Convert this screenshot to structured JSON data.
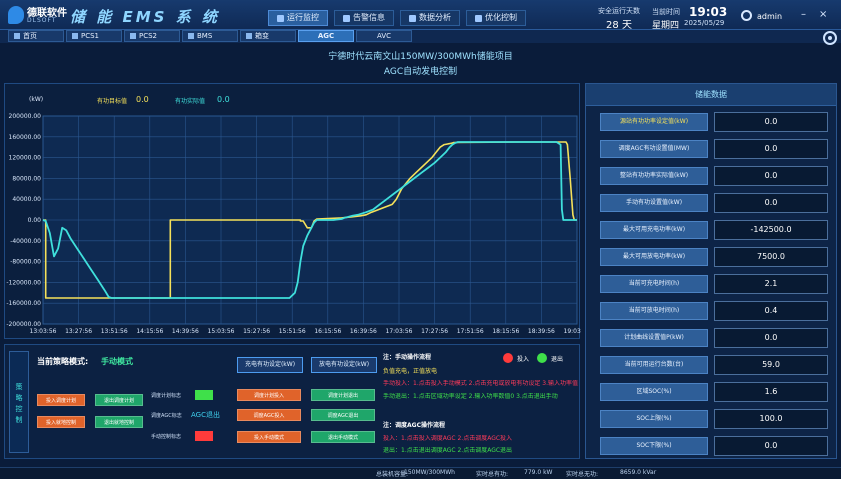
{
  "header": {
    "logo_text": "德联软件",
    "logo_sub": "DLSOFT",
    "system_title": "储 能 EMS 系 统",
    "nav": [
      {
        "label": "运行监控",
        "active": true,
        "icon": "monitor-icon"
      },
      {
        "label": "告警信息",
        "active": false,
        "icon": "alarm-icon"
      },
      {
        "label": "数据分析",
        "active": false,
        "icon": "chart-icon"
      },
      {
        "label": "优化控制",
        "active": false,
        "icon": "optimize-icon"
      }
    ],
    "run_days_label": "安全运行天数",
    "run_days_value": "28 天",
    "time_label": "当前时间",
    "weekday": "星期四",
    "clock": "19:03",
    "date": "2025/05/29",
    "user": "admin"
  },
  "tabs": [
    {
      "label": "首页",
      "active": false
    },
    {
      "label": "PCS1",
      "active": false
    },
    {
      "label": "PCS2",
      "active": false
    },
    {
      "label": "BMS",
      "active": false
    },
    {
      "label": "箱变",
      "active": false
    },
    {
      "label": "AGC",
      "active": true
    },
    {
      "label": "AVC",
      "active": false
    }
  ],
  "project": {
    "title": "宁德时代云南文山150MW/300MWh储能项目",
    "subtitle": "AGC自动发电控制"
  },
  "chart_data": {
    "type": "line",
    "unit": "(kW)",
    "ylim": [
      -200000,
      200000
    ],
    "y_ticks": [
      "200000.00",
      "160000.00",
      "120000.00",
      "80000.00",
      "40000.00",
      "0.00",
      "-40000.00",
      "-80000.00",
      "-120000.00",
      "-160000.00",
      "-200000.00"
    ],
    "y_tick_values": [
      200000,
      160000,
      120000,
      80000,
      40000,
      0,
      -40000,
      -80000,
      -120000,
      -160000,
      -200000
    ],
    "x_ticks": [
      "13:03:56",
      "13:27:56",
      "13:51:56",
      "14:15:56",
      "14:39:56",
      "15:03:56",
      "15:27:56",
      "15:51:56",
      "16:15:56",
      "16:39:56",
      "17:03:56",
      "17:27:56",
      "17:51:56",
      "18:15:56",
      "18:39:56",
      "19:03:56"
    ],
    "grid": true,
    "series": [
      {
        "name": "有功目标值",
        "current": "0.0",
        "color": "#f5e15a",
        "points": [
          [
            0,
            0
          ],
          [
            2,
            0
          ],
          [
            2,
            -150000
          ],
          [
            93,
            -150000
          ],
          [
            93,
            0
          ],
          [
            188,
            0
          ],
          [
            188,
            -2000
          ],
          [
            190,
            -2000
          ],
          [
            193,
            -15000
          ],
          [
            196,
            -15000
          ],
          [
            198,
            -2000
          ],
          [
            200,
            2000
          ],
          [
            218,
            4000
          ],
          [
            225,
            6000
          ],
          [
            232,
            8000
          ],
          [
            236,
            10000
          ],
          [
            240,
            15000
          ],
          [
            245,
            20000
          ],
          [
            250,
            25000
          ],
          [
            255,
            30000
          ],
          [
            258,
            40000
          ],
          [
            260,
            50000
          ],
          [
            262,
            60000
          ],
          [
            265,
            70000
          ],
          [
            268,
            80000
          ],
          [
            272,
            90000
          ],
          [
            276,
            100000
          ],
          [
            280,
            110000
          ],
          [
            284,
            120000
          ],
          [
            287,
            130000
          ],
          [
            290,
            140000
          ],
          [
            293,
            145000
          ],
          [
            295,
            146000
          ],
          [
            297,
            147000
          ],
          [
            299,
            148000
          ],
          [
            300,
            149000
          ],
          [
            348,
            150000
          ],
          [
            381,
            150000
          ],
          [
            382,
            150000
          ],
          [
            383,
            145000
          ],
          [
            385,
            80000
          ],
          [
            387,
            10000
          ],
          [
            388,
            0
          ],
          [
            390,
            0
          ]
        ]
      },
      {
        "name": "有功实际值",
        "current": "0.0",
        "color": "#3fe0dc",
        "points": [
          [
            0,
            0
          ],
          [
            2,
            -2000
          ],
          [
            5,
            -25000
          ],
          [
            8,
            -70000
          ],
          [
            11,
            -55000
          ],
          [
            14,
            -15000
          ],
          [
            17,
            -20000
          ],
          [
            20,
            -35000
          ],
          [
            25,
            -55000
          ],
          [
            30,
            -75000
          ],
          [
            35,
            -95000
          ],
          [
            40,
            -115000
          ],
          [
            45,
            -135000
          ],
          [
            48,
            -148000
          ],
          [
            50,
            -150000
          ],
          [
            180,
            -150000
          ],
          [
            184,
            -140000
          ],
          [
            186,
            -120000
          ],
          [
            188,
            -80000
          ],
          [
            190,
            -50000
          ],
          [
            193,
            -30000
          ],
          [
            196,
            -15000
          ],
          [
            198,
            -5000
          ],
          [
            200,
            0
          ],
          [
            208,
            0
          ],
          [
            212,
            0
          ],
          [
            218,
            2000
          ],
          [
            220,
            4000
          ],
          [
            223,
            6000
          ],
          [
            226,
            8000
          ],
          [
            230,
            10000
          ],
          [
            236,
            15000
          ],
          [
            241,
            20000
          ],
          [
            246,
            30000
          ],
          [
            251,
            40000
          ],
          [
            256,
            50000
          ],
          [
            261,
            60000
          ],
          [
            266,
            70000
          ],
          [
            271,
            80000
          ],
          [
            276,
            90000
          ],
          [
            281,
            100000
          ],
          [
            286,
            110000
          ],
          [
            290,
            120000
          ],
          [
            294,
            130000
          ],
          [
            297,
            140000
          ],
          [
            299,
            145000
          ],
          [
            301,
            148000
          ],
          [
            303,
            150000
          ],
          [
            375,
            150000
          ],
          [
            378,
            145000
          ],
          [
            379,
            20000
          ],
          [
            380,
            0
          ],
          [
            390,
            0
          ]
        ]
      }
    ]
  },
  "right_panel": {
    "title": "储能数据",
    "rows": [
      {
        "label": "源站有功功率设定值(kW)",
        "value": "0.0",
        "highlight": true
      },
      {
        "label": "调度AGC有功设置值(MW)",
        "value": "0.0",
        "highlight": false
      },
      {
        "label": "整站有功功率实际值(kW)",
        "value": "0.0",
        "highlight": false
      },
      {
        "label": "手动有功设置值(kW)",
        "value": "0.0",
        "highlight": false
      },
      {
        "label": "最大可用充电功率(kW)",
        "value": "-142500.0",
        "highlight": false
      },
      {
        "label": "最大可用放电功率(kW)",
        "value": "7500.0",
        "highlight": false
      },
      {
        "label": "当前可充电时间(h)",
        "value": "2.1",
        "highlight": false
      },
      {
        "label": "当前可放电时间(h)",
        "value": "0.4",
        "highlight": false
      },
      {
        "label": "计划曲线设置值P(kW)",
        "value": "0.0",
        "highlight": false
      },
      {
        "label": "当前可用运行台数(台)",
        "value": "59.0",
        "highlight": false
      },
      {
        "label": "区域SOC(%)",
        "value": "1.6",
        "highlight": false
      },
      {
        "label": "SOC上限(%)",
        "value": "100.0",
        "highlight": false
      },
      {
        "label": "SOC下限(%)",
        "value": "0.0",
        "highlight": false
      }
    ]
  },
  "control": {
    "side_label": [
      "策",
      "略",
      "控",
      "制"
    ],
    "strategy_label": "当前策略模式:",
    "strategy_value": "手动模式",
    "btn_plan_in": "投入调度计划",
    "btn_plan_out": "退出调度计划",
    "btn_local_in": "投入就地控制",
    "btn_local_out": "退出就地控制",
    "lbl_plan_flag": "调度计划标志",
    "lbl_agc_flag": "调度AGC标志",
    "lbl_manual_flag": "手动控制标志",
    "agc_text": "AGC退出",
    "btn_plan_commit": "调度计划投入",
    "btn_plan_exit": "调度计划退出",
    "btn_agc_in": "调度AGC投入",
    "btn_agc_out": "调度AGC退出",
    "btn_manual_in": "投入手动模式",
    "btn_manual_out": "退出手动模式",
    "btn_charge": "充电有功设定(kW)",
    "btn_discharge": "放电有功设定(kW)",
    "note1_title": "注：手动操作流程",
    "note1_line1": "负值充电，正值放电",
    "note1_line2": "手动投入：1.点击投入手动模式 2.点击充电或放电有功设定 3.输入功率值",
    "note1_line3": "手动退出：1.点击区域功率设定 2.输入功率数值0 3.点击退出手动",
    "note2_title": "注：调度AGC操作流程",
    "note2_line1": "投入：1.点击投入调度AGC 2.点击调度AGC投入",
    "note2_line2": "退出：1.点击退出调度AGC 2.点击调度AGC退出",
    "legend_in": "投入",
    "legend_out": "退出"
  },
  "colors": {
    "on": "#ff3b3b",
    "off": "#3fe04a",
    "orange": "#e0632a",
    "green": "#1fa66a"
  },
  "status": {
    "total_capacity_label": "总装机容量:",
    "total_capacity": "150MW/300MWh",
    "active_power_label": "实时总有功:",
    "active_power": "779.0 kW",
    "reactive_power_label": "实时总无功:",
    "reactive_power": "8659.0 kVar"
  }
}
